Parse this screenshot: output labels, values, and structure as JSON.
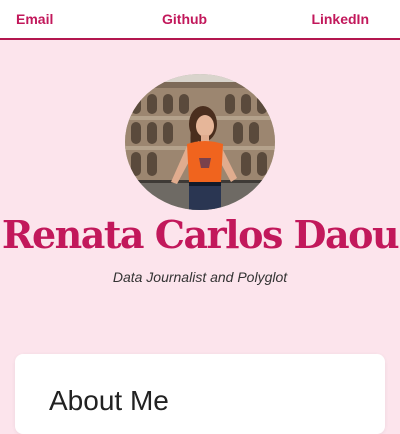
{
  "nav": {
    "email_label": "Email",
    "github_label": "Github",
    "linkedin_label": "LinkedIn"
  },
  "hero": {
    "name": "Renata Carlos Daou",
    "subtitle": "Data Journalist and Polyglot"
  },
  "about": {
    "heading": "About Me"
  },
  "colors": {
    "background": "#fce4ec",
    "accent": "#c2185b",
    "nav_border": "#b3164f",
    "card": "#ffffff"
  }
}
